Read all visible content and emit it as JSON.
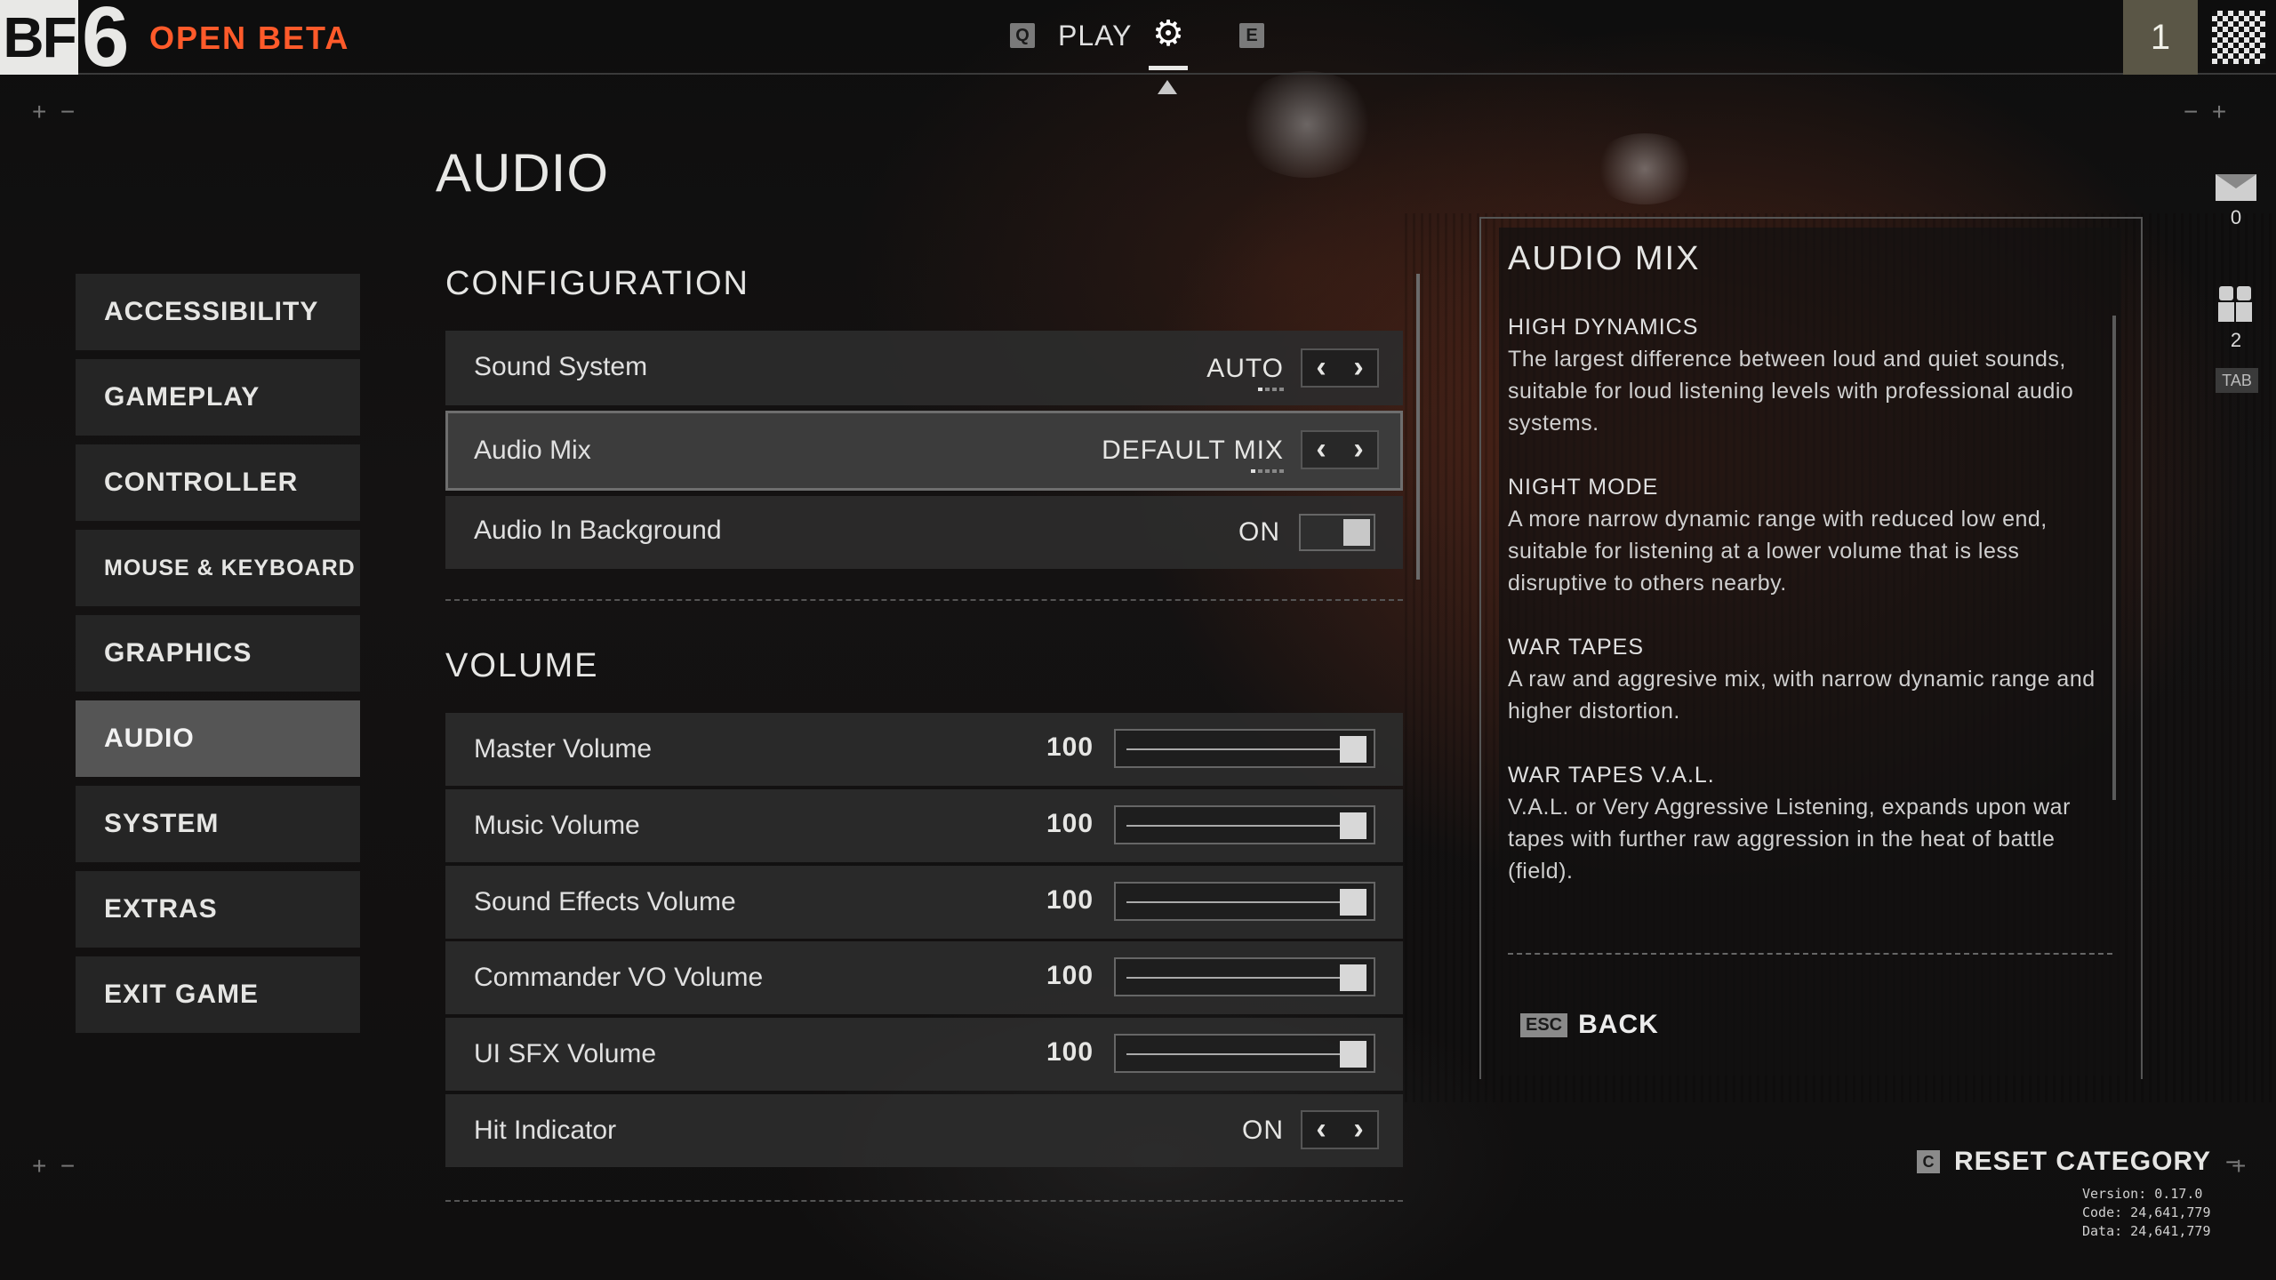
{
  "topbar": {
    "logo_bf": "BF",
    "logo_six": "6",
    "open_beta": "OPEN BETA",
    "left_key": "Q",
    "play_label": "PLAY",
    "settings_icon": "gear-icon",
    "right_key": "E",
    "player_level": "1"
  },
  "page_title": "AUDIO",
  "sidebar": {
    "items": [
      {
        "label": "ACCESSIBILITY"
      },
      {
        "label": "GAMEPLAY"
      },
      {
        "label": "CONTROLLER"
      },
      {
        "label": "MOUSE & KEYBOARD"
      },
      {
        "label": "GRAPHICS"
      },
      {
        "label": "AUDIO",
        "active": true
      },
      {
        "label": "SYSTEM"
      },
      {
        "label": "EXTRAS"
      },
      {
        "label": "EXIT GAME"
      }
    ]
  },
  "configuration": {
    "title": "CONFIGURATION",
    "sound_system": {
      "label": "Sound System",
      "value": "AUTO"
    },
    "audio_mix": {
      "label": "Audio Mix",
      "value": "DEFAULT MIX"
    },
    "audio_in_background": {
      "label": "Audio In Background",
      "value": "ON",
      "enabled": true
    }
  },
  "volume": {
    "title": "VOLUME",
    "master": {
      "label": "Master Volume",
      "value": "100"
    },
    "music": {
      "label": "Music Volume",
      "value": "100"
    },
    "sound_effects": {
      "label": "Sound Effects Volume",
      "value": "100"
    },
    "commander_vo": {
      "label": "Commander VO Volume",
      "value": "100"
    },
    "ui_sfx": {
      "label": "UI SFX Volume",
      "value": "100"
    },
    "hit_indicator": {
      "label": "Hit Indicator",
      "value": "ON"
    }
  },
  "info_panel": {
    "title": "AUDIO MIX",
    "sections": [
      {
        "heading": "HIGH DYNAMICS",
        "body": "The largest difference between loud and quiet sounds, suitable for loud listening levels with professional audio systems."
      },
      {
        "heading": "NIGHT MODE",
        "body": "A more narrow dynamic range with reduced low end, suitable for listening at a lower volume that is less disruptive to others nearby."
      },
      {
        "heading": "WAR TAPES",
        "body": "A raw and aggresive mix, with narrow dynamic range and higher distortion."
      },
      {
        "heading": "WAR TAPES V.A.L.",
        "body": "V.A.L. or Very Aggressive Listening, expands upon war tapes with further raw aggression in the heat of battle (field)."
      }
    ],
    "back_key": "ESC",
    "back_label": "BACK"
  },
  "right_rail": {
    "mail_count": "0",
    "friends_count": "2",
    "tab_key": "TAB"
  },
  "footer": {
    "reset_key": "C",
    "reset_label": "RESET CATEGORY",
    "version": "Version: 0.17.0",
    "code": "Code: 24,641,779",
    "data": "Data: 24,641,779"
  },
  "colors": {
    "accent": "#ff5a2a",
    "row_bg": "#2c2c2c",
    "active_tab": "#555555"
  }
}
